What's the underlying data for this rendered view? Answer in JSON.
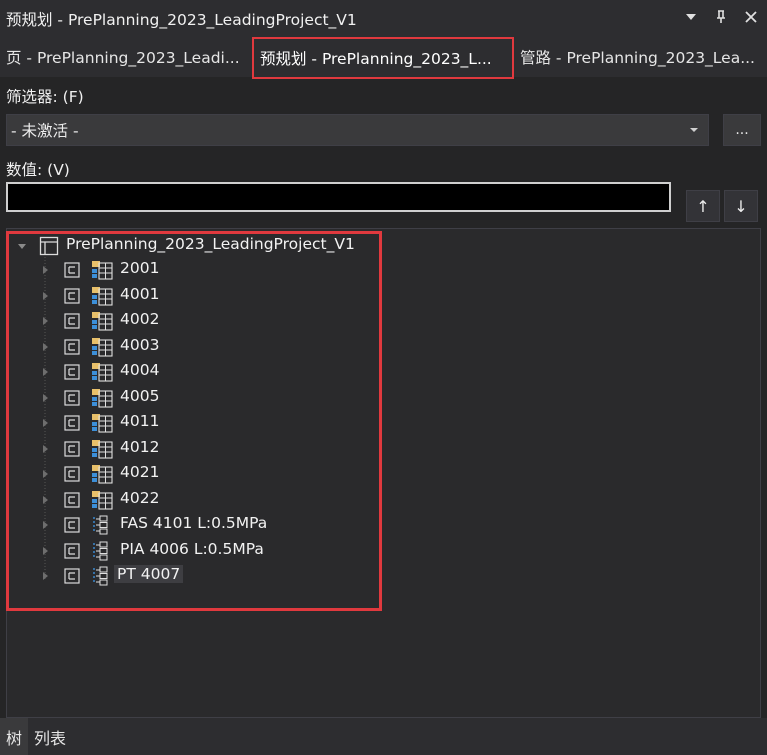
{
  "window": {
    "title": "预规划 - PrePlanning_2023_LeadingProject_V1"
  },
  "controls": {
    "dropdown_glyph": "▾",
    "pin_glyph": "ᵠ",
    "close_glyph": "✕"
  },
  "tabs": [
    {
      "label": "页 - PrePlanning_2023_Leadi..."
    },
    {
      "label": "预规划 - PrePlanning_2023_L..."
    },
    {
      "label": "管路 - PrePlanning_2023_Lea..."
    }
  ],
  "filter": {
    "label": "筛选器: (F)",
    "value": "- 未激活 -",
    "more_label": "..."
  },
  "value": {
    "label": "数值: (V)",
    "text": ""
  },
  "nav": {
    "up": "↑",
    "down": "↓"
  },
  "tree": {
    "root": {
      "label": "PrePlanning_2023_LeadingProject_V1"
    },
    "items": [
      {
        "label": "2001",
        "icon": "grid-icon"
      },
      {
        "label": "4001",
        "icon": "grid-icon"
      },
      {
        "label": "4002",
        "icon": "grid-icon"
      },
      {
        "label": "4003",
        "icon": "grid-icon"
      },
      {
        "label": "4004",
        "icon": "grid-icon"
      },
      {
        "label": "4005",
        "icon": "grid-icon"
      },
      {
        "label": "4011",
        "icon": "grid-icon"
      },
      {
        "label": "4012",
        "icon": "grid-icon"
      },
      {
        "label": "4021",
        "icon": "grid-icon"
      },
      {
        "label": "4022",
        "icon": "grid-icon"
      },
      {
        "label": "FAS 4101 L:0.5MPa",
        "icon": "pipe-icon"
      },
      {
        "label": "PIA 4006 L:0.5MPa",
        "icon": "pipe-icon"
      },
      {
        "label": "PT 4007",
        "icon": "pipe-icon",
        "selected": true
      }
    ]
  },
  "bottom_tabs": [
    {
      "label": "树"
    },
    {
      "label": "列表"
    }
  ],
  "colors": {
    "accent_red": "#e0393e",
    "background": "#252526"
  }
}
